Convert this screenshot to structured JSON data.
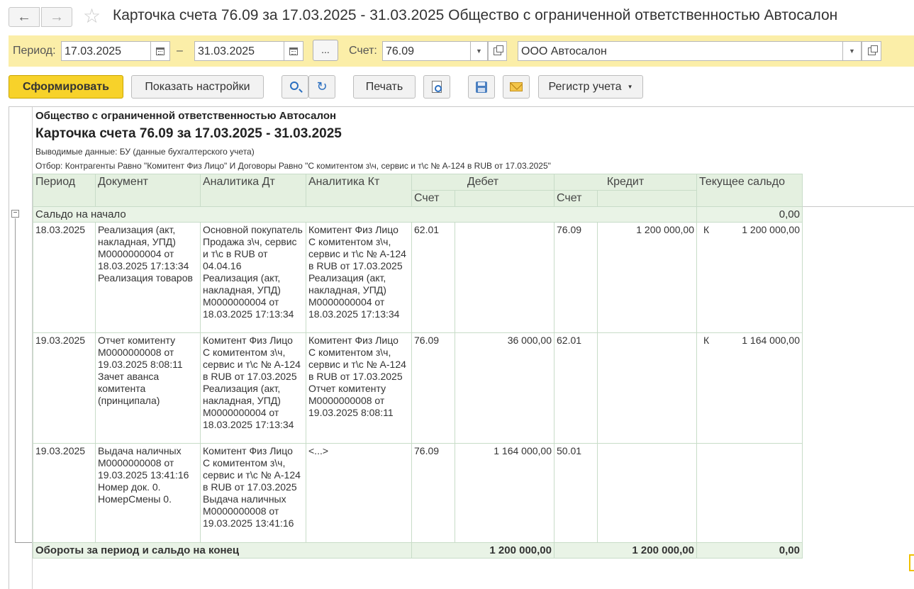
{
  "window": {
    "title": "Карточка счета 76.09 за 17.03.2025 - 31.03.2025 Общество с ограниченной ответственностью Автосалон",
    "back_icon": "arrow-left-icon",
    "forward_icon": "arrow-right-icon",
    "favorite_icon": "star-icon"
  },
  "params": {
    "period_label": "Период:",
    "date_from": "17.03.2025",
    "dash": "–",
    "date_to": "31.03.2025",
    "dots_label": "...",
    "account_label": "Счет:",
    "account_value": "76.09",
    "org_value": "ООО Автосалон"
  },
  "toolbar": {
    "generate": "Сформировать",
    "show_settings": "Показать настройки",
    "print": "Печать",
    "register": "Регистр учета"
  },
  "report": {
    "org": "Общество с ограниченной ответственностью Автосалон",
    "title": "Карточка счета 76.09 за 17.03.2025 - 31.03.2025",
    "output_data": "Выводимые данные:  БУ (данные бухгалтерского учета)",
    "filter": "Отбор:  Контрагенты Равно \"Комитент Физ Лицо\" И Договоры Равно \"С комитентом з\\ч, сервис и т\\с № А-124 в RUB от 17.03.2025\"",
    "headers": {
      "period": "Период",
      "document": "Документ",
      "analytics_dt": "Аналитика Дт",
      "analytics_kt": "Аналитика Кт",
      "debit": "Дебет",
      "credit": "Кредит",
      "balance": "Текущее сальдо",
      "account": "Счет"
    },
    "opening": {
      "label": "Сальдо на начало",
      "value": "0,00"
    },
    "rows": [
      {
        "period": "18.03.2025",
        "document": "Реализация (акт, накладная, УПД) М0000000004 от 18.03.2025 17:13:34 Реализация товаров",
        "analytics_dt": "Основной покупатель\nПродажа з\\ч, сервис и т\\с в RUB от 04.04.16\nРеализация (акт, накладная, УПД) М0000000004 от 18.03.2025 17:13:34",
        "analytics_kt": "Комитент Физ Лицо\nС комитентом з\\ч, сервис и т\\с № А-124 в RUB от 17.03.2025\nРеализация (акт, накладная, УПД) М0000000004 от 18.03.2025 17:13:34",
        "debit_account": "62.01",
        "debit_sum": "",
        "credit_account": "76.09",
        "credit_sum": "1 200 000,00",
        "balance_side": "К",
        "balance": "1 200 000,00"
      },
      {
        "period": "19.03.2025",
        "document": "Отчет комитенту М0000000008 от 19.03.2025 8:08:11\nЗачет аванса комитента (принципала)",
        "analytics_dt": "Комитент Физ Лицо\nС комитентом з\\ч, сервис и т\\с № А-124 в RUB от 17.03.2025\nРеализация (акт, накладная, УПД) М0000000004 от 18.03.2025 17:13:34",
        "analytics_kt": "Комитент Физ Лицо\nС комитентом з\\ч, сервис и т\\с № А-124 в RUB от 17.03.2025\nОтчет комитенту М0000000008 от 19.03.2025 8:08:11",
        "debit_account": "76.09",
        "debit_sum": "36 000,00",
        "credit_account": "62.01",
        "credit_sum": "",
        "balance_side": "К",
        "balance": "1 164 000,00"
      },
      {
        "period": "19.03.2025",
        "document": "Выдача наличных М0000000008 от 19.03.2025 13:41:16\nНомер док.  0.\nНомерСмены 0.",
        "analytics_dt": "Комитент Физ Лицо\nС комитентом з\\ч, сервис и т\\с № А-124 в RUB от 17.03.2025\nВыдача наличных М0000000008 от 19.03.2025 13:41:16",
        "analytics_kt": "<...>",
        "debit_account": "76.09",
        "debit_sum": "1 164 000,00",
        "credit_account": "50.01",
        "credit_sum": "",
        "balance_side": "",
        "balance": ""
      }
    ],
    "totals": {
      "label": "Обороты за период и сальдо на конец",
      "debit": "1 200 000,00",
      "credit": "1 200 000,00",
      "balance": "0,00"
    }
  }
}
